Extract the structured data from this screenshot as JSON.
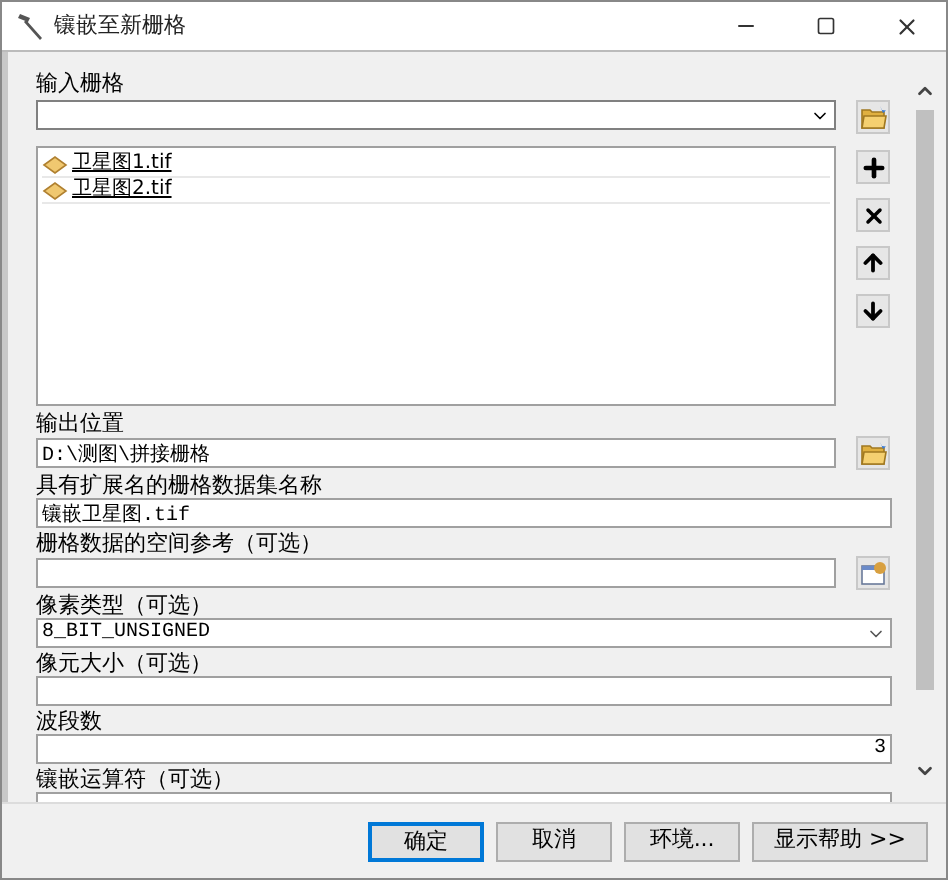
{
  "window": {
    "title": "镶嵌至新栅格"
  },
  "input": {
    "label": "输入栅格",
    "items": [
      {
        "name": "卫星图1.tif"
      },
      {
        "name": "卫星图2.tif"
      }
    ]
  },
  "fields": [
    {
      "kind": "path",
      "label": "输出位置",
      "value": "D:\\测图\\拼接栅格"
    },
    {
      "kind": "text",
      "label": "具有扩展名的栅格数据集名称",
      "value": "镶嵌卫星图.tif"
    },
    {
      "kind": "reference",
      "label": "栅格数据的空间参考（可选）"
    },
    {
      "kind": "select",
      "label": "像素类型（可选）",
      "value": "8_BIT_UNSIGNED"
    },
    {
      "kind": "text",
      "label": "像元大小（可选）"
    },
    {
      "kind": "number",
      "label": "波段数",
      "value": "3"
    },
    {
      "kind": "text",
      "label": "镶嵌运算符（可选）"
    }
  ],
  "buttons": [
    {
      "label": "确定",
      "selected": true
    },
    {
      "label": "取消",
      "selected": false
    },
    {
      "label": "环境...",
      "selected": false
    },
    {
      "label": "显示帮助 >>",
      "selected": false
    }
  ]
}
